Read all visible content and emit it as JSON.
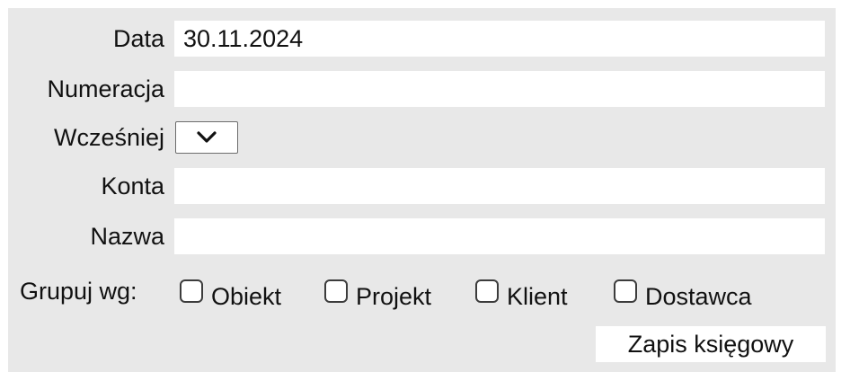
{
  "form": {
    "data": {
      "label": "Data",
      "value": "30.11.2024"
    },
    "numeracja": {
      "label": "Numeracja",
      "value": ""
    },
    "wczesniej": {
      "label": "Wcześniej",
      "selected": ""
    },
    "konta": {
      "label": "Konta",
      "value": ""
    },
    "nazwa": {
      "label": "Nazwa",
      "value": ""
    },
    "grupuj": {
      "label": "Grupuj wg:",
      "options": [
        {
          "label": "Obiekt",
          "checked": false
        },
        {
          "label": "Projekt",
          "checked": false
        },
        {
          "label": "Klient",
          "checked": false
        },
        {
          "label": "Dostawca",
          "checked": false
        }
      ]
    },
    "submit_label": "Zapis księgowy"
  },
  "colors": {
    "panel_background": "#e8e8e8",
    "field_background": "#ffffff",
    "text": "#111111"
  },
  "icons": {
    "select_arrow": "chevron-down-icon"
  }
}
